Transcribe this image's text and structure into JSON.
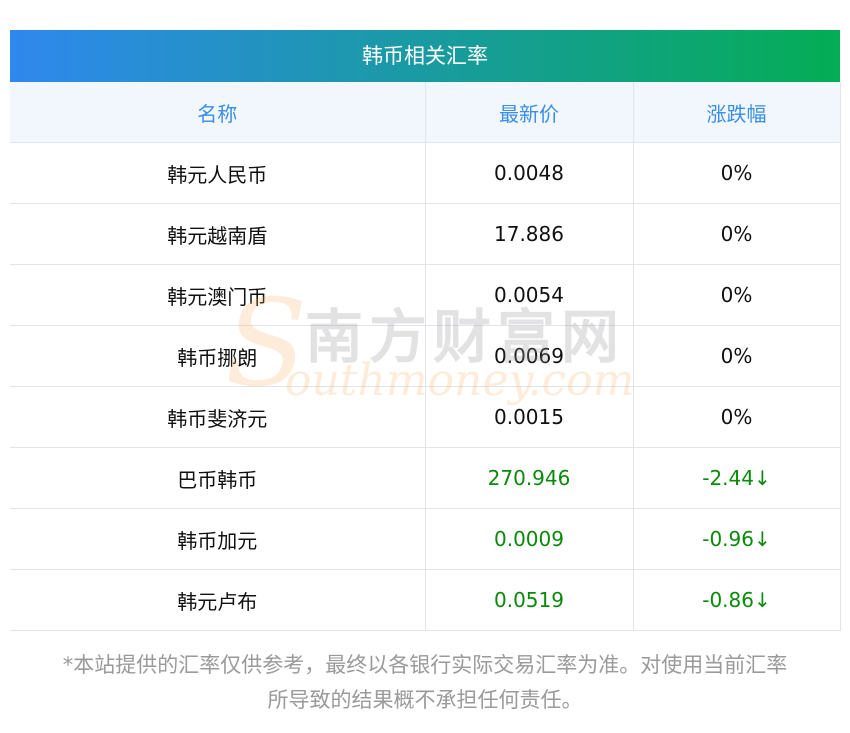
{
  "title": "韩币相关汇率",
  "headers": [
    "名称",
    "最新价",
    "涨跌幅"
  ],
  "rows": [
    {
      "name": "韩元人民币",
      "price": "0.0048",
      "change": "0%",
      "trend": "flat"
    },
    {
      "name": "韩元越南盾",
      "price": "17.886",
      "change": "0%",
      "trend": "flat"
    },
    {
      "name": "韩元澳门币",
      "price": "0.0054",
      "change": "0%",
      "trend": "flat"
    },
    {
      "name": "韩币挪朗",
      "price": "0.0069",
      "change": "0%",
      "trend": "flat"
    },
    {
      "name": "韩币斐济元",
      "price": "0.0015",
      "change": "0%",
      "trend": "flat"
    },
    {
      "name": "巴币韩币",
      "price": "270.946",
      "change": "-2.44↓",
      "trend": "down"
    },
    {
      "name": "韩币加元",
      "price": "0.0009",
      "change": "-0.96↓",
      "trend": "down"
    },
    {
      "name": "韩元卢布",
      "price": "0.0519",
      "change": "-0.86↓",
      "trend": "down"
    }
  ],
  "disclaimer": {
    "line1": "*本站提供的汇率仅供参考，最终以各银行实际交易汇率为准。对使用当前汇率",
    "line2": "所导致的结果概不承担任何责任。"
  },
  "watermark": {
    "cn": "南方财富网",
    "en": "outhmoney.com",
    "s": "S"
  },
  "colors": {
    "gradient_start": "#2f88ee",
    "gradient_end": "#04ad55",
    "header_text": "#3a8ee6",
    "down": "#0a8a0a"
  }
}
